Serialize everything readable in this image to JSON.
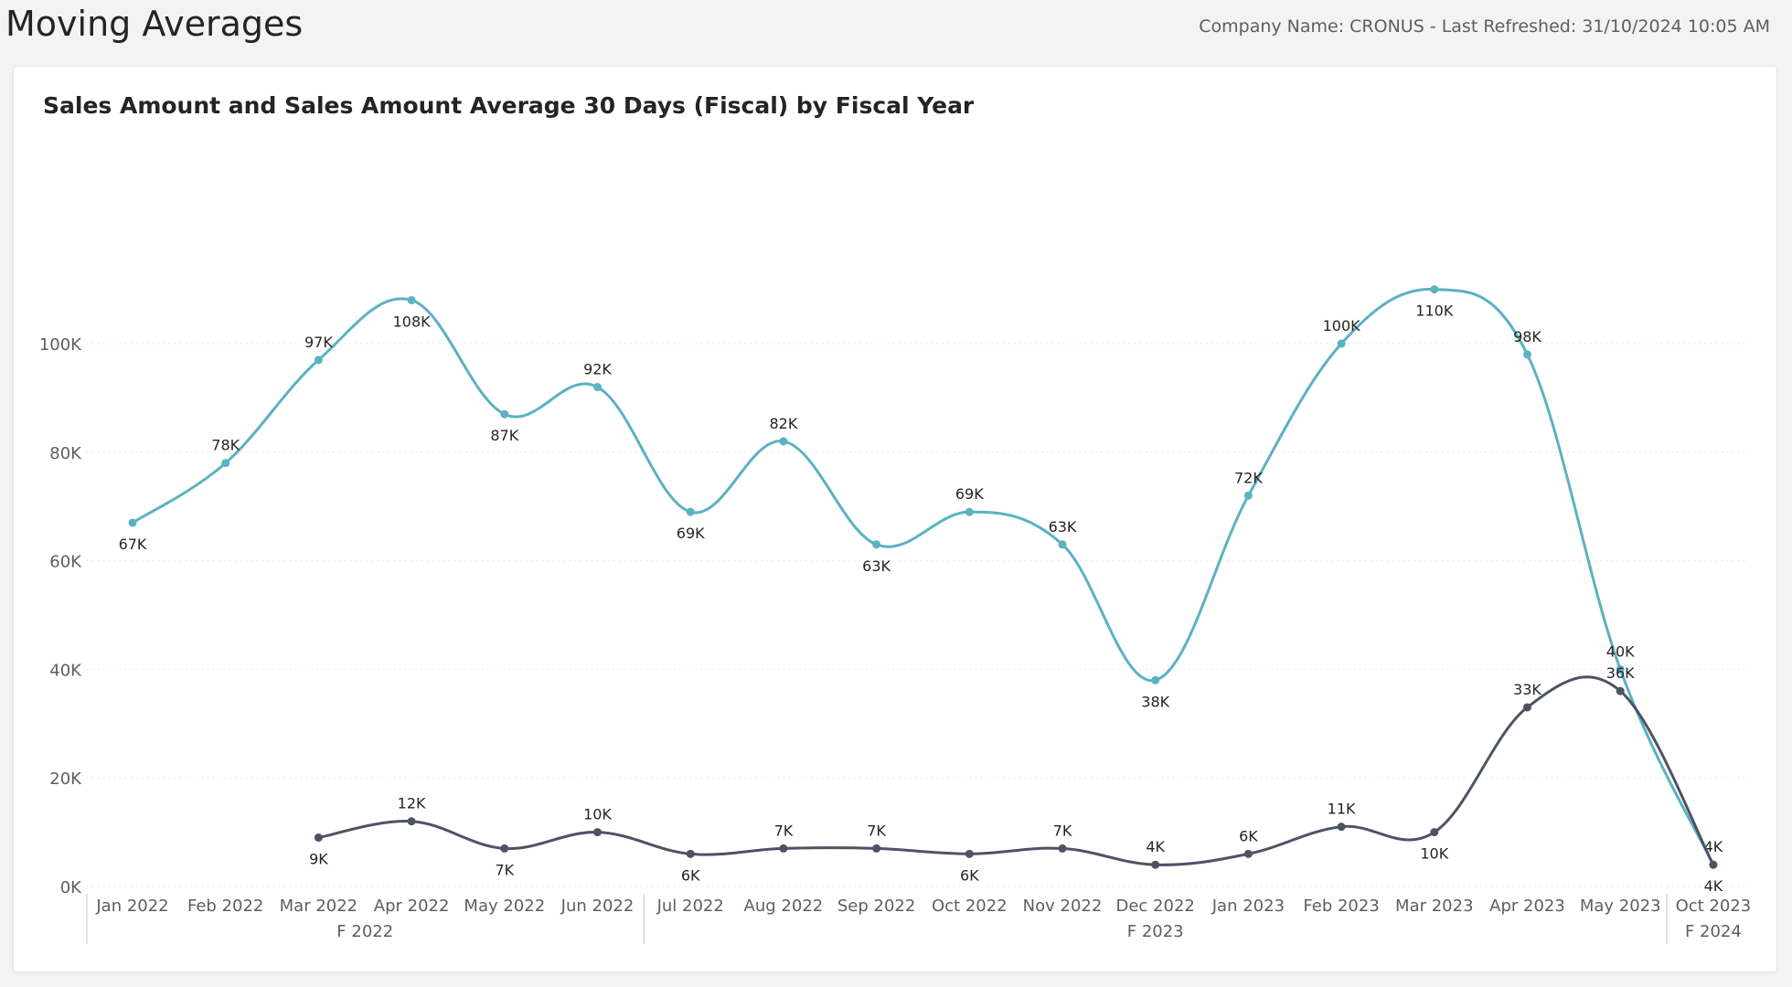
{
  "page": {
    "title": "Moving Averages",
    "refresh_info": "Company Name: CRONUS - Last Refreshed: 31/10/2024 10:05 AM"
  },
  "chart_data": {
    "type": "line",
    "title": "Sales Amount and Sales Amount Average 30 Days (Fiscal) by Fiscal Year",
    "xlabel": "",
    "ylabel": "",
    "ylim": [
      0,
      110000
    ],
    "yticks": [
      {
        "value": 0,
        "label": "0K"
      },
      {
        "value": 20000,
        "label": "20K"
      },
      {
        "value": 40000,
        "label": "40K"
      },
      {
        "value": 60000,
        "label": "60K"
      },
      {
        "value": 80000,
        "label": "80K"
      },
      {
        "value": 100000,
        "label": "100K"
      }
    ],
    "grid": true,
    "legend": "none",
    "categories": [
      "Jan 2022",
      "Feb 2022",
      "Mar 2022",
      "Apr 2022",
      "May 2022",
      "Jun 2022",
      "Jul 2022",
      "Aug 2022",
      "Sep 2022",
      "Oct 2022",
      "Nov 2022",
      "Dec 2022",
      "Jan 2023",
      "Feb 2023",
      "Mar 2023",
      "Apr 2023",
      "May 2023",
      "Oct 2023"
    ],
    "groups": [
      {
        "label": "F 2022",
        "start": 0,
        "end": 5
      },
      {
        "label": "F 2023",
        "start": 6,
        "end": 16
      },
      {
        "label": "F 2024",
        "start": 17,
        "end": 17
      }
    ],
    "series": [
      {
        "color": "#5bb2c0",
        "values": [
          67000,
          78000,
          97000,
          108000,
          87000,
          92000,
          69000,
          82000,
          63000,
          69000,
          63000,
          38000,
          72000,
          100000,
          110000,
          98000,
          40000,
          4000
        ],
        "labels": [
          "67K",
          "78K",
          "97K",
          "108K",
          "87K",
          "92K",
          "69K",
          "82K",
          "63K",
          "69K",
          "63K",
          "38K",
          "72K",
          "100K",
          "110K",
          "98K",
          "40K",
          "4K"
        ],
        "label_pos": [
          "below",
          "above",
          "above",
          "below",
          "below",
          "above",
          "below",
          "above",
          "below",
          "above",
          "above",
          "below",
          "above",
          "above",
          "below",
          "above",
          "above",
          "above"
        ]
      },
      {
        "color": "#4c5364",
        "values": [
          null,
          null,
          9000,
          12000,
          7000,
          10000,
          6000,
          7000,
          7000,
          6000,
          7000,
          4000,
          6000,
          11000,
          10000,
          33000,
          36000,
          4000
        ],
        "labels": [
          "",
          "",
          "9K",
          "12K",
          "7K",
          "10K",
          "6K",
          "7K",
          "7K",
          "6K",
          "7K",
          "4K",
          "6K",
          "11K",
          "10K",
          "33K",
          "36K",
          "4K"
        ],
        "label_pos": [
          "",
          "",
          "below",
          "above",
          "below",
          "above",
          "below",
          "above",
          "above",
          "below",
          "above",
          "above",
          "above",
          "above",
          "below",
          "above",
          "above",
          "below"
        ]
      }
    ]
  }
}
